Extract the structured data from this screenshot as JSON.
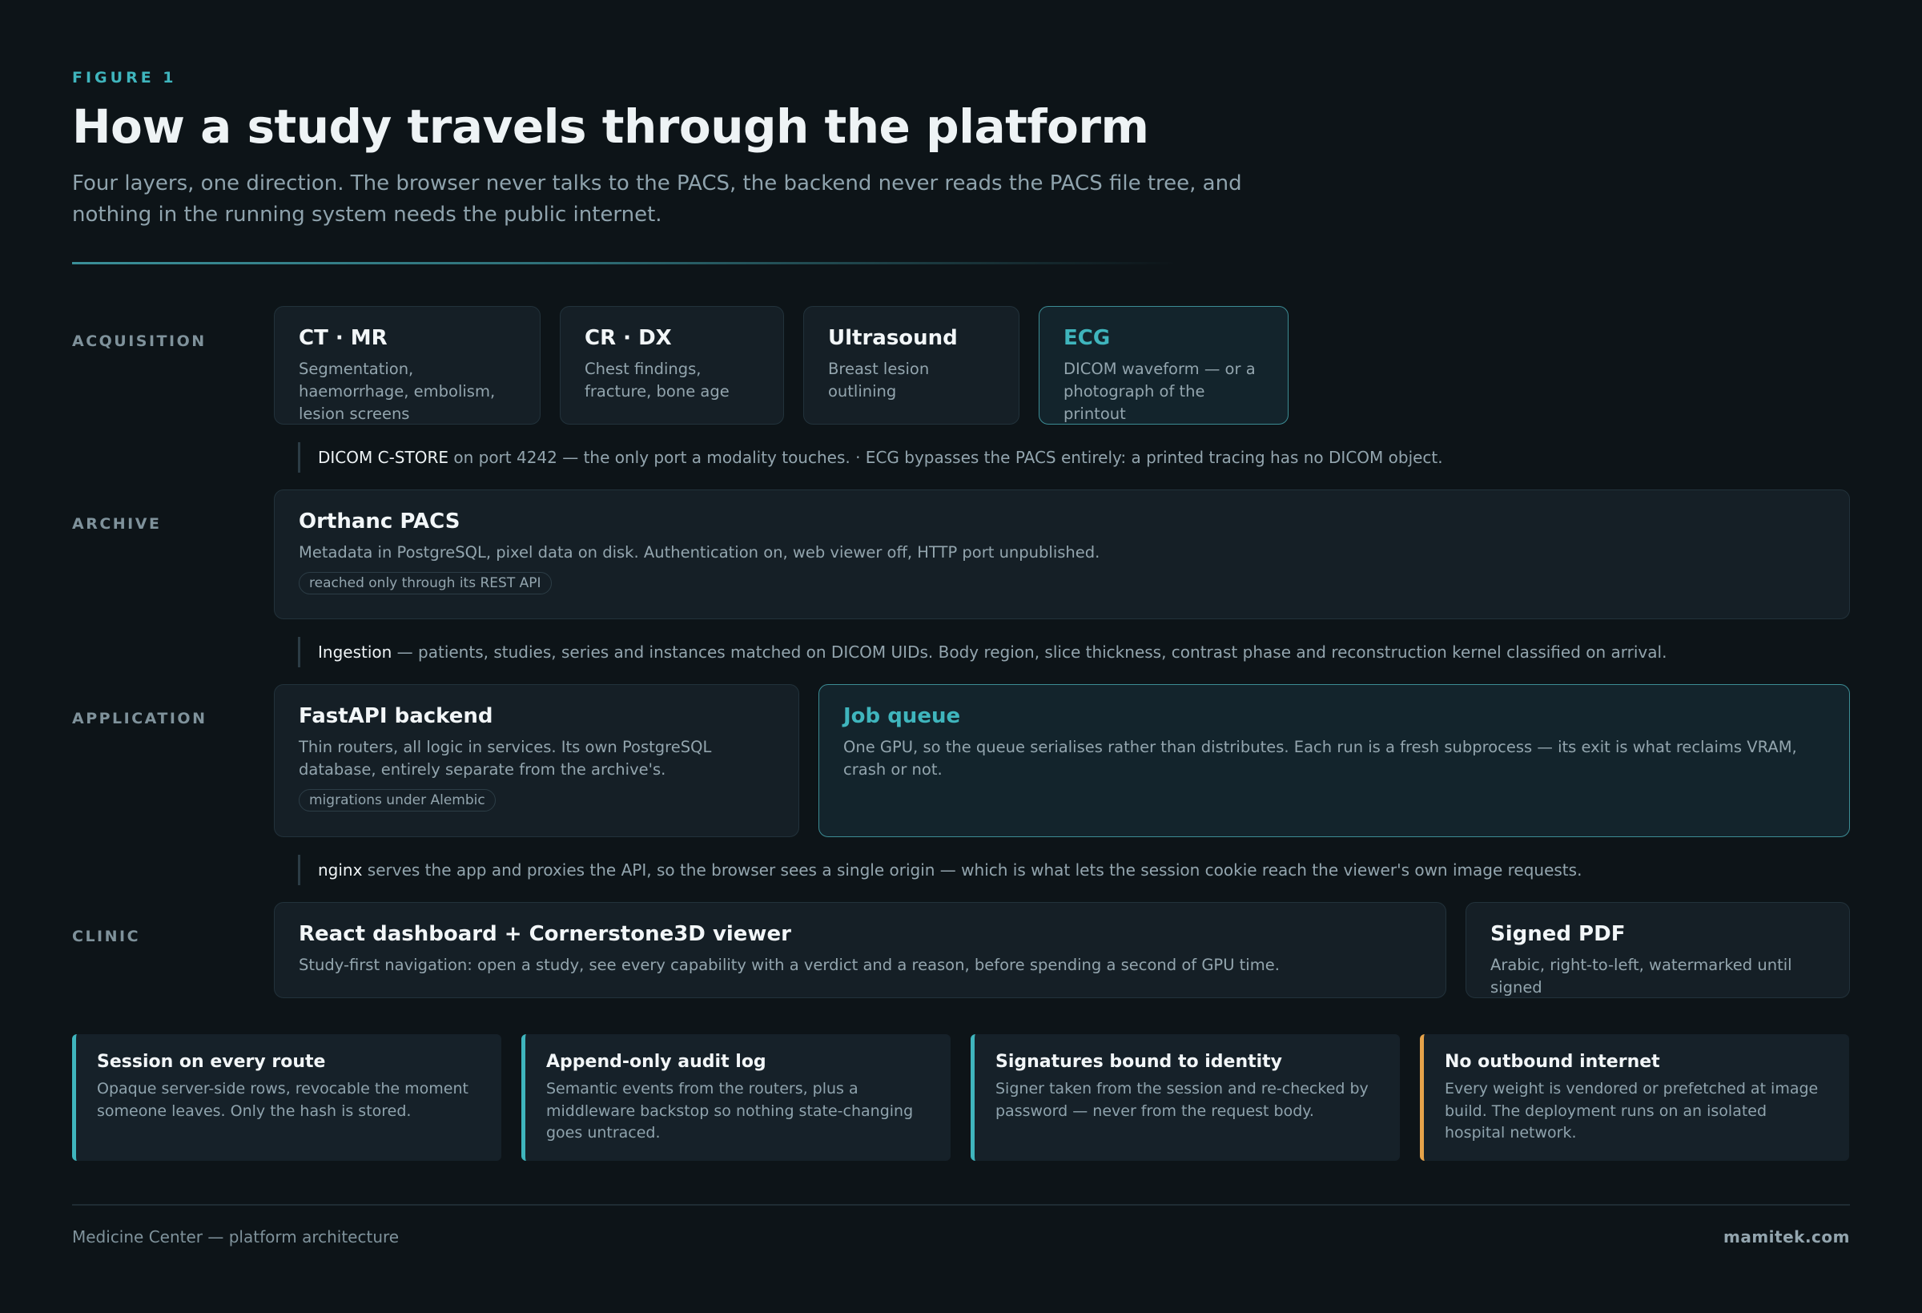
{
  "header": {
    "eyebrow": "FIGURE 1",
    "title": "How a study travels through the platform",
    "subtitle": "Four layers, one direction. The browser never talks to the PACS, the backend never reads the PACS file tree, and nothing in the running system needs the public internet."
  },
  "layers": {
    "acquisition": {
      "label": "ACQUISITION",
      "cards": [
        {
          "title": "CT · MR",
          "desc": "Segmentation, haemorrhage, embolism, lesion screens"
        },
        {
          "title": "CR · DX",
          "desc": "Chest findings, fracture, bone age"
        },
        {
          "title": "Ultrasound",
          "desc": "Breast lesion outlining"
        },
        {
          "title": "ECG",
          "desc": "DICOM waveform — or a photograph of the printout"
        }
      ]
    },
    "archive": {
      "label": "ARCHIVE",
      "card": {
        "title": "Orthanc PACS",
        "desc": "Metadata in PostgreSQL, pixel data on disk. Authentication on, web viewer off, HTTP port unpublished.",
        "pill": "reached only through its REST API"
      }
    },
    "application": {
      "label": "APPLICATION",
      "backend": {
        "title": "FastAPI backend",
        "desc": "Thin routers, all logic in services. Its own PostgreSQL database, entirely separate from the archive's.",
        "pill": "migrations under Alembic"
      },
      "queue": {
        "title": "Job queue",
        "desc": "One GPU, so the queue serialises rather than distributes. Each run is a fresh subprocess — its exit is what reclaims VRAM, crash or not."
      }
    },
    "clinic": {
      "label": "CLINIC",
      "dashboard": {
        "title": "React dashboard + Cornerstone3D viewer",
        "desc": "Study-first navigation: open a study, see every capability with a verdict and a reason, before spending a second of GPU time."
      },
      "pdf": {
        "title": "Signed PDF",
        "desc": "Arabic, right-to-left, watermarked until signed"
      }
    }
  },
  "connectors": {
    "c1": {
      "key": "DICOM C-STORE",
      "text": " on port 4242 — the only port a modality touches.  ·  ECG bypasses the PACS entirely: a printed tracing has no DICOM object."
    },
    "c2": {
      "key": "Ingestion",
      "text": " — patients, studies, series and instances matched on DICOM UIDs. Body region, slice thickness, contrast phase and reconstruction kernel classified on arrival."
    },
    "c3": {
      "key": "nginx",
      "text": " serves the app and proxies the API, so the browser sees a single origin — which is what lets the session cookie reach the viewer's own image requests."
    }
  },
  "principles": [
    {
      "title": "Session on every route",
      "desc": "Opaque server-side rows, revocable the moment someone leaves. Only the hash is stored."
    },
    {
      "title": "Append-only audit log",
      "desc": "Semantic events from the routers, plus a middleware backstop so nothing state-changing goes untraced."
    },
    {
      "title": "Signatures bound to identity",
      "desc": "Signer taken from the session and re-checked by password — never from the request body."
    },
    {
      "title": "No outbound internet",
      "desc": "Every weight is vendored or prefetched at image build. The deployment runs on an isolated hospital network."
    }
  ],
  "footer": {
    "left": "Medicine Center — platform architecture",
    "right": "mamitek.com"
  },
  "colors": {
    "accent": "#3fb5bd",
    "warning": "#e6a34a",
    "background": "#0d1418"
  }
}
